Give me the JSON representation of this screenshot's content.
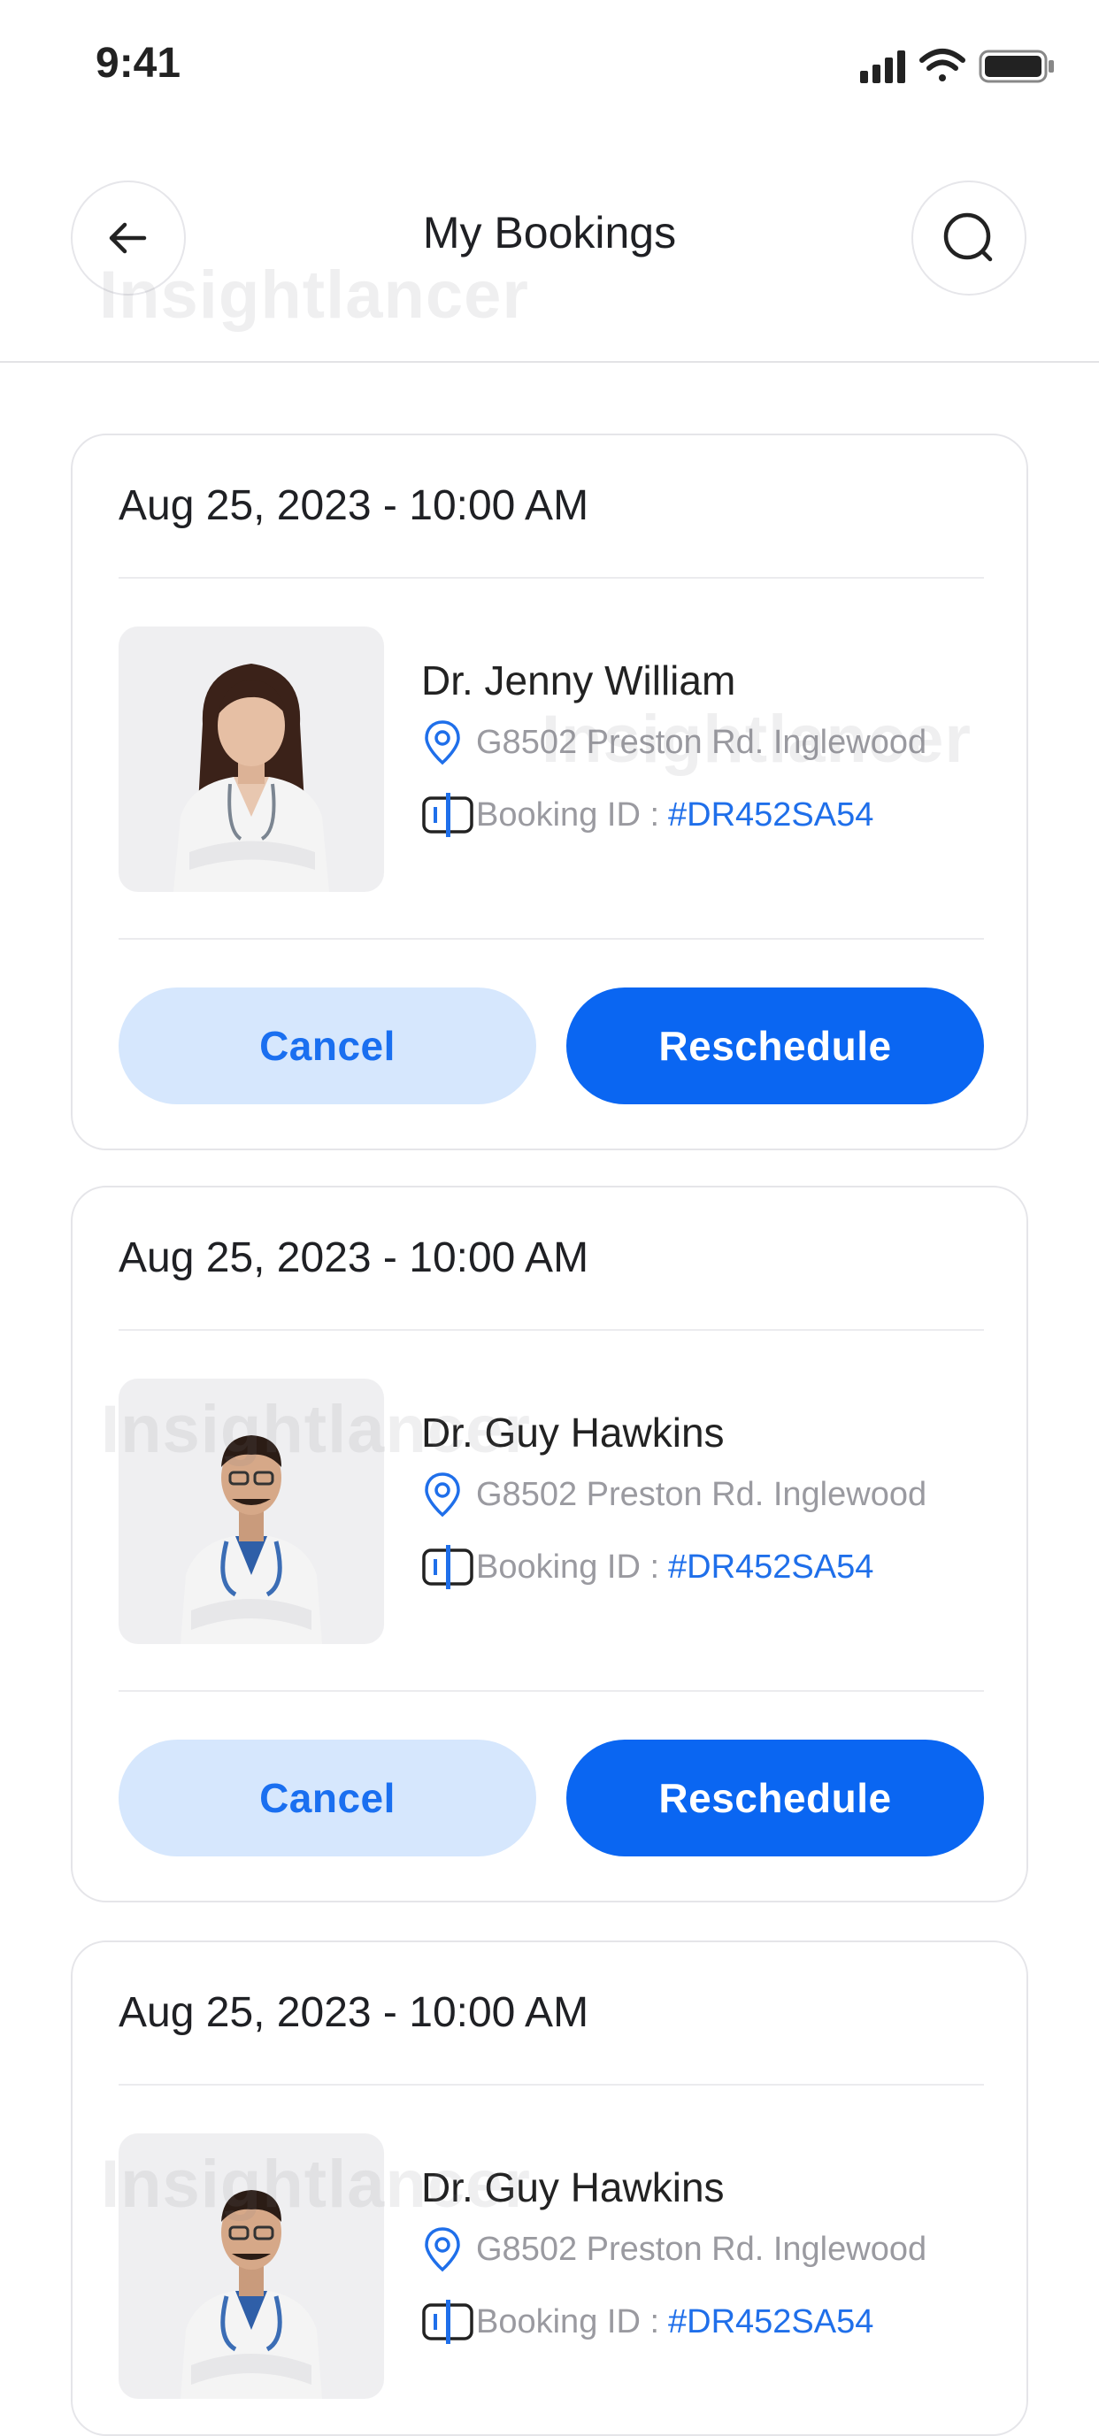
{
  "status_bar": {
    "time": "9:41"
  },
  "header": {
    "title": "My Bookings"
  },
  "watermark": "Insightlancer",
  "colors": {
    "accent": "#0a66f2",
    "accent_light": "#d6e7fd",
    "link": "#1f6fea"
  },
  "icons": [
    "signal-icon",
    "wifi-icon",
    "battery-icon",
    "back-arrow-icon",
    "search-icon",
    "location-pin-icon",
    "id-card-icon"
  ],
  "bookings": [
    {
      "date": "Aug 25, 2023 - 10:00 AM",
      "doctor": "Dr. Jenny William",
      "address": "G8502 Preston Rd. Inglewood",
      "booking_label": "Booking ID :",
      "booking_id": "#DR452SA54",
      "cancel": "Cancel",
      "reschedule": "Reschedule"
    },
    {
      "date": "Aug 25, 2023 - 10:00 AM",
      "doctor": "Dr. Guy Hawkins",
      "address": "G8502 Preston Rd. Inglewood",
      "booking_label": "Booking ID :",
      "booking_id": "#DR452SA54",
      "cancel": "Cancel",
      "reschedule": "Reschedule"
    },
    {
      "date": "Aug 25, 2023 - 10:00 AM",
      "doctor": "Dr. Guy Hawkins",
      "address": "G8502 Preston Rd. Inglewood",
      "booking_label": "Booking ID :",
      "booking_id": "#DR452SA54"
    }
  ]
}
